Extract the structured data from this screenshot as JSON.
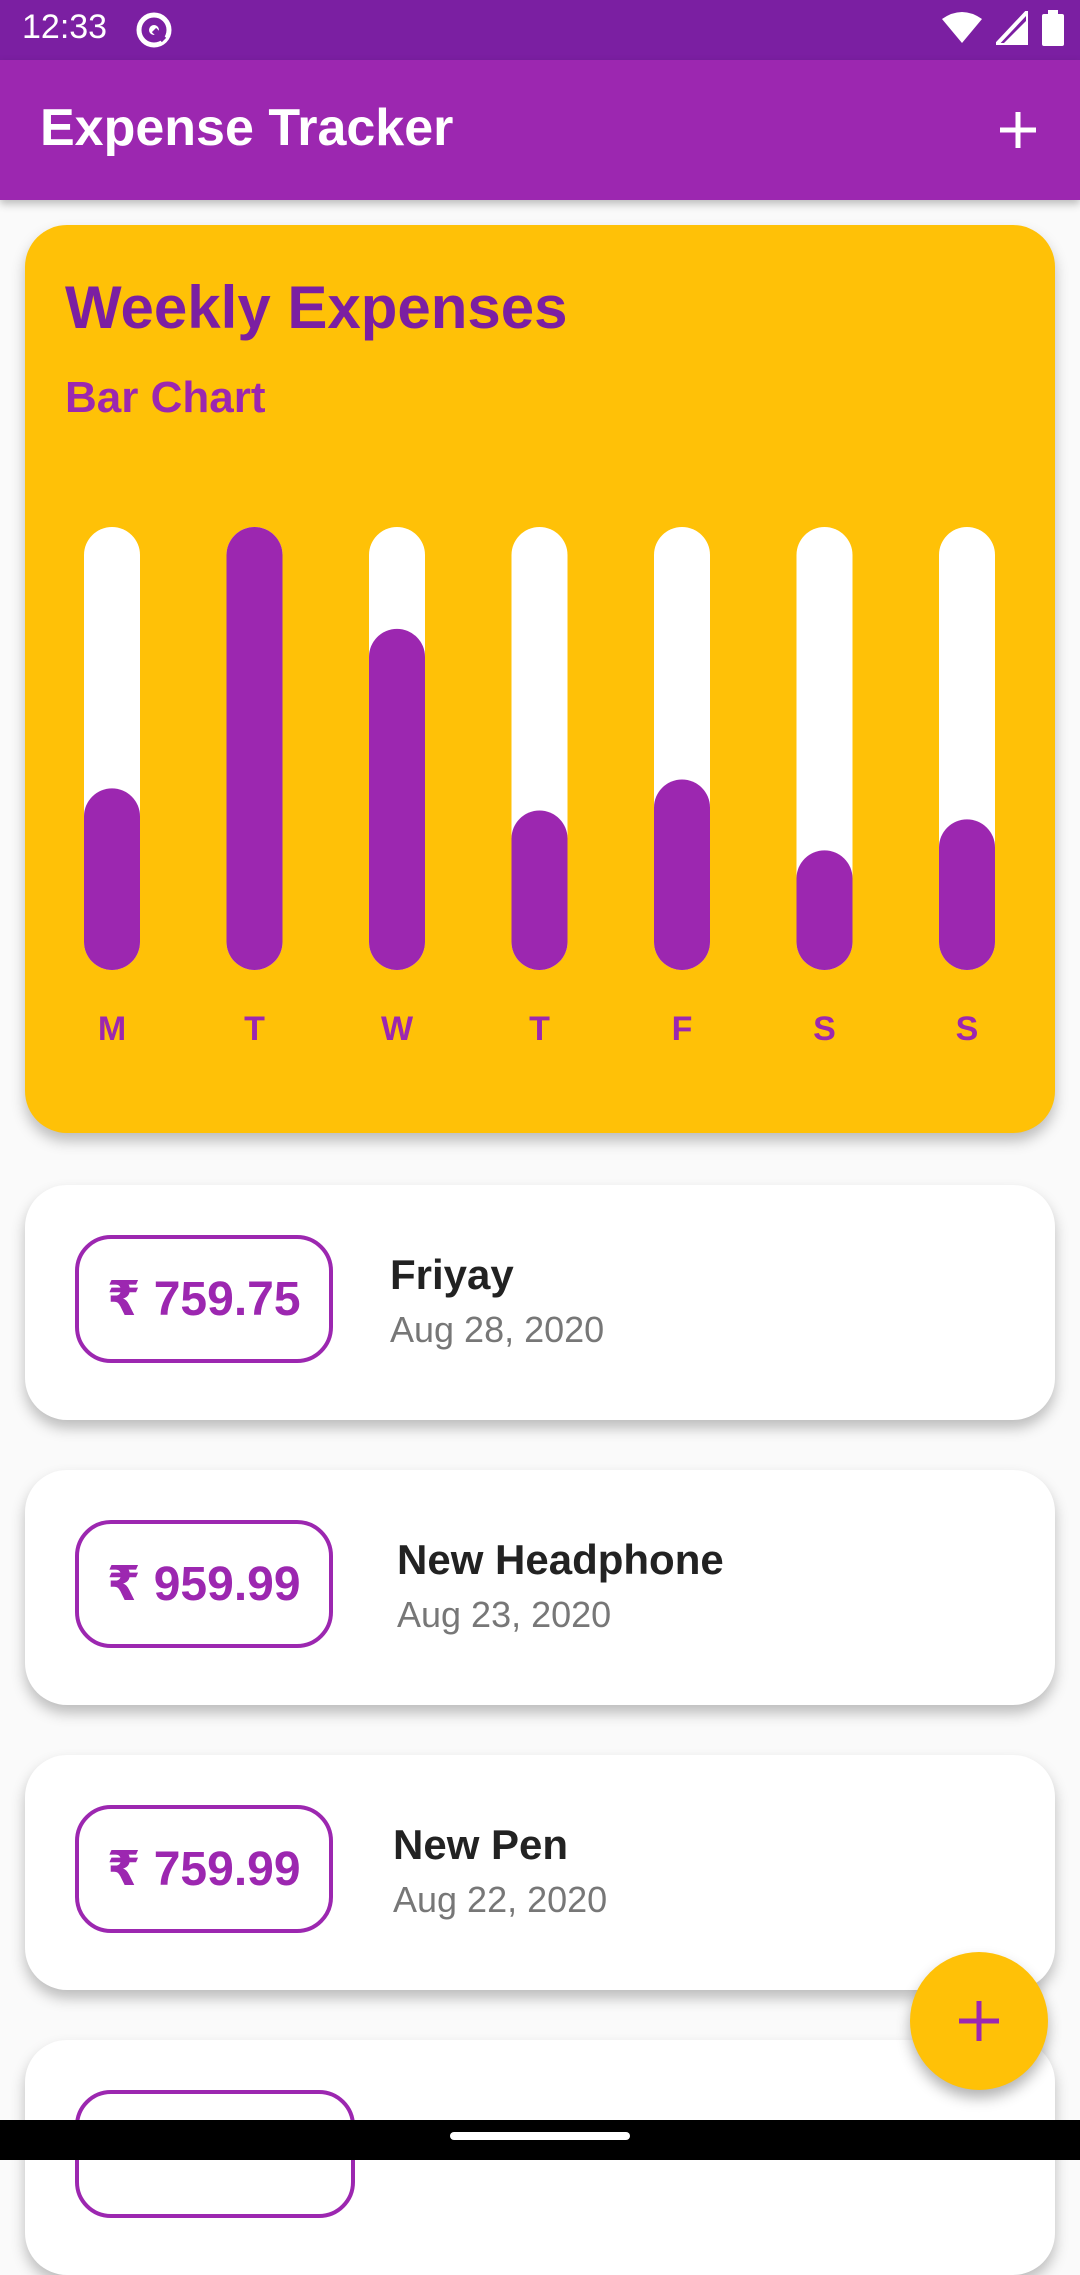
{
  "status_bar": {
    "time": "12:33"
  },
  "app_bar": {
    "title": "Expense Tracker",
    "add_icon": "plus-icon"
  },
  "chart_card": {
    "title": "Weekly Expenses",
    "subtitle": "Bar Chart"
  },
  "chart_data": {
    "type": "bar",
    "categories": [
      "M",
      "T",
      "W",
      "T",
      "F",
      "S",
      "S"
    ],
    "values": [
      0.41,
      1.0,
      0.77,
      0.36,
      0.43,
      0.27,
      0.34
    ],
    "ylim": [
      0,
      1
    ],
    "title": "",
    "xlabel": "",
    "ylabel": ""
  },
  "transactions": [
    {
      "amount": "₹ 759.75",
      "title": "Friyay",
      "date": "Aug 28, 2020"
    },
    {
      "amount": "₹ 959.99",
      "title": "New Headphone",
      "date": "Aug 23, 2020"
    },
    {
      "amount": "₹ 759.99",
      "title": "New Pen",
      "date": "Aug 22, 2020"
    }
  ],
  "colors": {
    "primary": "#9c27b0",
    "primary_dark": "#7b1fa2",
    "accent": "#ffc107"
  },
  "fab": {
    "icon": "plus-icon"
  }
}
